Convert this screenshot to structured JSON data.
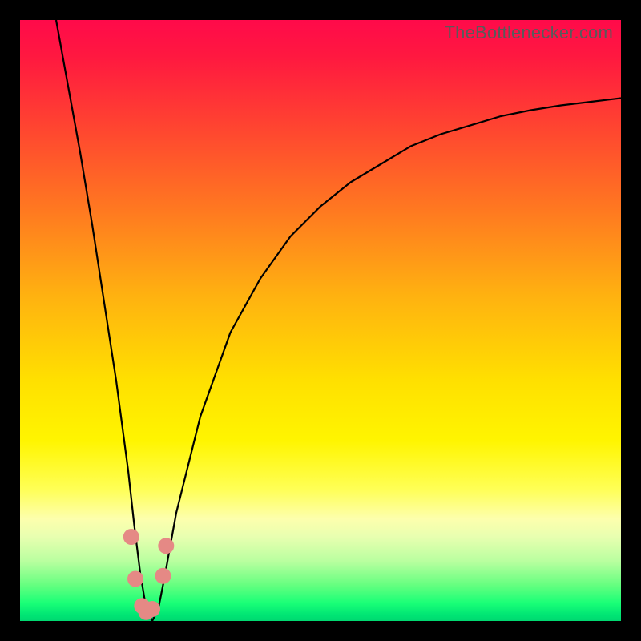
{
  "credit_text": "TheBottlenecker.com",
  "colors": {
    "frame": "#000000",
    "curve_stroke": "#000000",
    "marker_fill": "#e58985",
    "credit_text": "#5a5a5a"
  },
  "chart_data": {
    "type": "line",
    "title": "",
    "xlabel": "",
    "ylabel": "",
    "xlim": [
      0,
      100
    ],
    "ylim": [
      0,
      100
    ],
    "note": "No axis ticks or numeric labels are shown in the image; x and y values below are estimated from pixel positions on a 0–100 plot-area scale. y=100 is top (red / high bottleneck), y≈0 is bottom (green / no bottleneck). The curve minimum sits near x≈21.",
    "series": [
      {
        "name": "bottleneck-curve",
        "x": [
          6,
          8,
          10,
          12,
          14,
          16,
          18,
          19,
          20,
          21,
          22,
          23,
          24,
          26,
          30,
          35,
          40,
          45,
          50,
          55,
          60,
          65,
          70,
          75,
          80,
          85,
          90,
          95,
          100
        ],
        "y": [
          100,
          89,
          78,
          66,
          53,
          40,
          25,
          16,
          8,
          2,
          0,
          2,
          7,
          18,
          34,
          48,
          57,
          64,
          69,
          73,
          76,
          79,
          81,
          82.5,
          84,
          85,
          85.8,
          86.4,
          87
        ]
      }
    ],
    "markers": {
      "name": "highlight-dots",
      "note": "Pink dots clustered around the curve minimum (bottom of the V).",
      "points": [
        {
          "x": 18.5,
          "y": 14
        },
        {
          "x": 19.2,
          "y": 7
        },
        {
          "x": 20.3,
          "y": 2.5
        },
        {
          "x": 21.0,
          "y": 1.5
        },
        {
          "x": 22.0,
          "y": 2.0
        },
        {
          "x": 23.8,
          "y": 7.5
        },
        {
          "x": 24.3,
          "y": 12.5
        }
      ]
    }
  }
}
